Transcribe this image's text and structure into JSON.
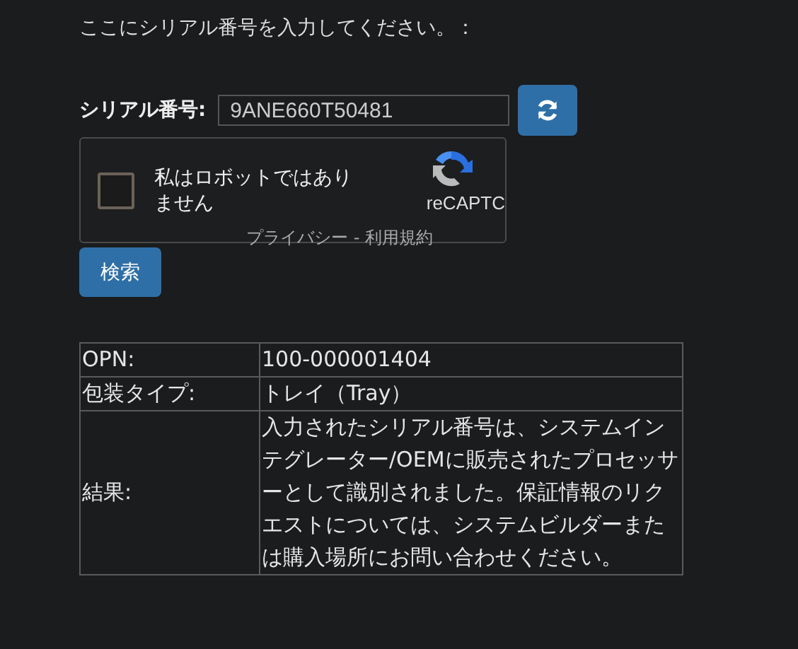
{
  "instruction": "ここにシリアル番号を入力してください。：",
  "serial": {
    "label": "シリアル番号:",
    "value": "9ANE660T50481"
  },
  "captcha": {
    "checked": false,
    "label": "私はロボットではありません",
    "brand": "reCAPTC",
    "links": "プライバシー - 利用規約"
  },
  "search_button": "検索",
  "table": {
    "rows": [
      {
        "label": "OPN:",
        "value": "100-000001404"
      },
      {
        "label": "包装タイプ:",
        "value": "トレイ（Tray）"
      },
      {
        "label": "結果:",
        "value": "入力されたシリアル番号は、システムインテグレーター/OEMに販売されたプロセッサーとして識別されました。保証情報のリクエストについては、システムビルダーまたは購入場所にお問い合わせください。"
      }
    ]
  }
}
